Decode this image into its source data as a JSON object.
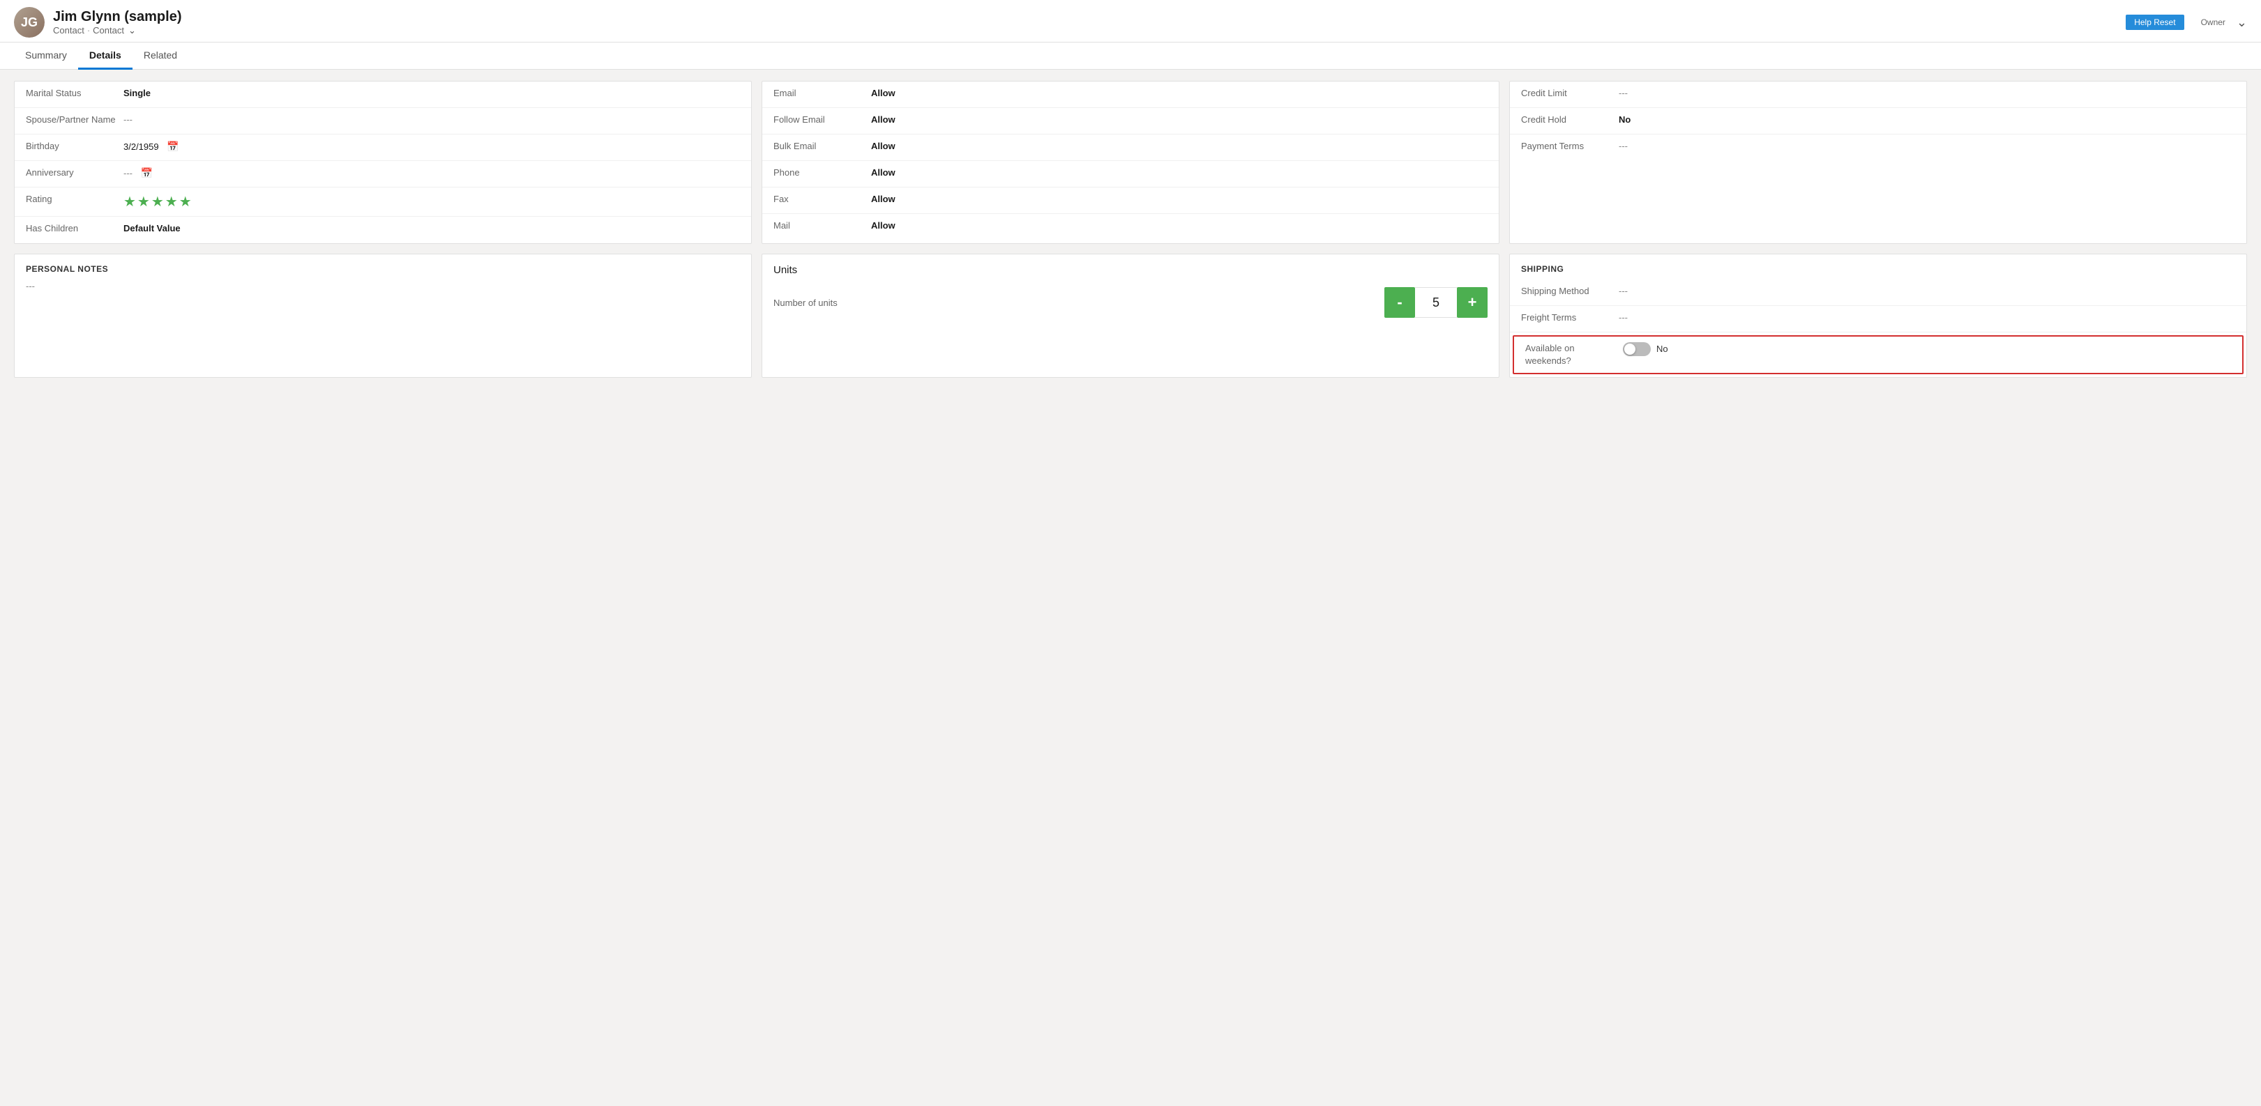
{
  "header": {
    "name": "Jim Glynn (sample)",
    "subtitle1": "Contact",
    "subtitle2": "Contact",
    "owner": "Owner",
    "help_btn": "Help  Reset"
  },
  "tabs": [
    {
      "label": "Summary",
      "active": false
    },
    {
      "label": "Details",
      "active": true
    },
    {
      "label": "Related",
      "active": false
    }
  ],
  "personal_info": {
    "title": "",
    "fields": [
      {
        "label": "Marital Status",
        "value": "Single",
        "bold": true,
        "dash": false
      },
      {
        "label": "Spouse/Partner Name",
        "value": "---",
        "bold": false,
        "dash": true
      },
      {
        "label": "Birthday",
        "value": "3/2/1959",
        "bold": false,
        "dash": false,
        "calendar": true
      },
      {
        "label": "Anniversary",
        "value": "---",
        "bold": false,
        "dash": true,
        "calendar": true
      },
      {
        "label": "Rating",
        "value": "★★★★★",
        "bold": false,
        "dash": false,
        "stars": true
      },
      {
        "label": "Has Children",
        "value": "Default Value",
        "bold": true,
        "dash": false
      }
    ]
  },
  "contact_preferences": {
    "fields": [
      {
        "label": "Email",
        "value": "Allow",
        "bold": true
      },
      {
        "label": "Follow Email",
        "value": "Allow",
        "bold": true
      },
      {
        "label": "Bulk Email",
        "value": "Allow",
        "bold": true
      },
      {
        "label": "Phone",
        "value": "Allow",
        "bold": true
      },
      {
        "label": "Fax",
        "value": "Allow",
        "bold": true
      },
      {
        "label": "Mail",
        "value": "Allow",
        "bold": true
      }
    ]
  },
  "billing": {
    "fields": [
      {
        "label": "Credit Limit",
        "value": "---",
        "bold": false,
        "dash": true
      },
      {
        "label": "Credit Hold",
        "value": "No",
        "bold": true,
        "dash": false
      },
      {
        "label": "Payment Terms",
        "value": "---",
        "bold": false,
        "dash": true
      }
    ]
  },
  "personal_notes": {
    "title": "PERSONAL NOTES",
    "content": "---"
  },
  "units": {
    "title": "Units",
    "number_of_units_label": "Number of units",
    "value": "5",
    "minus_label": "-",
    "plus_label": "+"
  },
  "shipping": {
    "section_title": "SHIPPING",
    "fields": [
      {
        "label": "Shipping Method",
        "value": "---",
        "bold": false,
        "dash": true
      },
      {
        "label": "Freight Terms",
        "value": "---",
        "bold": false,
        "dash": true
      }
    ],
    "available_weekends_label": "Available on weekends?",
    "available_weekends_value": "No"
  }
}
